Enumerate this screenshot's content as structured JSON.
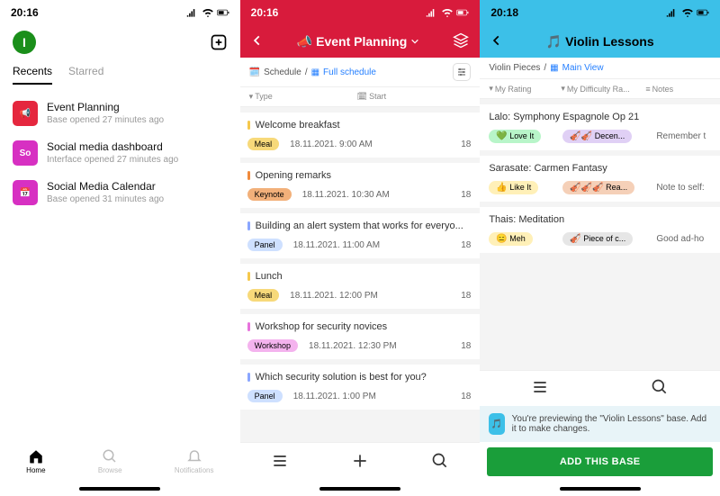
{
  "s1": {
    "time": "20:16",
    "avatar_initial": "I",
    "tabs": {
      "recents": "Recents",
      "starred": "Starred"
    },
    "rows": [
      {
        "icon": "📢",
        "color": "#e5273e",
        "title": "Event Planning",
        "sub": "Base opened 27 minutes ago"
      },
      {
        "icon": "So",
        "color": "#d730c2",
        "title": "Social media dashboard",
        "sub": "Interface opened 27 minutes ago"
      },
      {
        "icon": "📅",
        "color": "#d730c2",
        "title": "Social Media Calendar",
        "sub": "Base opened 31 minutes ago"
      }
    ],
    "footer": {
      "home": "Home",
      "browse": "Browse",
      "notifications": "Notifications"
    }
  },
  "s2": {
    "time": "20:16",
    "title": "Event Planning",
    "crumb": {
      "schedule": "Schedule",
      "full": "Full schedule"
    },
    "cols": {
      "type": "Type",
      "start": "Start"
    },
    "records": [
      {
        "stripe": "#f5c84c",
        "title": "Welcome breakfast",
        "type": "Meal",
        "typeColor": "#f7d97a",
        "date": "18.11.2021. 9:00 AM",
        "end": "18"
      },
      {
        "stripe": "#f08a3c",
        "title": "Opening remarks",
        "type": "Keynote",
        "typeColor": "#f2b07a",
        "date": "18.11.2021. 10:30 AM",
        "end": "18"
      },
      {
        "stripe": "#8aa6ff",
        "title": "Building an alert system that works for everyo...",
        "type": "Panel",
        "typeColor": "#cee0ff",
        "date": "18.11.2021. 11:00 AM",
        "end": "18"
      },
      {
        "stripe": "#f5c84c",
        "title": "Lunch",
        "type": "Meal",
        "typeColor": "#f7d97a",
        "date": "18.11.2021. 12:00 PM",
        "end": "18"
      },
      {
        "stripe": "#e773dc",
        "title": "Workshop for security novices",
        "type": "Workshop",
        "typeColor": "#f4b3ee",
        "date": "18.11.2021. 12:30 PM",
        "end": "18"
      },
      {
        "stripe": "#8aa6ff",
        "title": "Which security solution is best for you?",
        "type": "Panel",
        "typeColor": "#cee0ff",
        "date": "18.11.2021. 1:00 PM",
        "end": "18"
      }
    ]
  },
  "s3": {
    "time": "20:18",
    "title": "Violin Lessons",
    "crumb": {
      "table": "Violin Pieces",
      "view": "Main View"
    },
    "cols": {
      "rating": "My Rating",
      "difficulty": "My Difficulty Ra...",
      "notes": "Notes"
    },
    "records": [
      {
        "title": "Lalo: Symphony Espagnole Op 21",
        "rating": "Love It",
        "ratingEmoji": "💚",
        "ratingColor": "#b8f5c9",
        "difficulty": "Decen...",
        "diffEmoji": "🎻🎻",
        "diffColor": "#e0d0f5",
        "notes": "Remember t"
      },
      {
        "title": "Sarasate: Carmen Fantasy",
        "rating": "Like It",
        "ratingEmoji": "👍",
        "ratingColor": "#fff0b8",
        "difficulty": "Rea...",
        "diffEmoji": "🎻🎻🎻",
        "diffColor": "#f5d0b8",
        "notes": "Note to self:"
      },
      {
        "title": "Thais: Meditation",
        "rating": "Meh",
        "ratingEmoji": "😑",
        "ratingColor": "#fff0b8",
        "difficulty": "Piece of c...",
        "diffEmoji": "🎻",
        "diffColor": "#e6e6e6",
        "notes": "Good ad-ho"
      }
    ],
    "preview_text": "You're previewing the \"Violin Lessons\" base. Add it to make changes.",
    "add_btn": "ADD THIS BASE"
  }
}
